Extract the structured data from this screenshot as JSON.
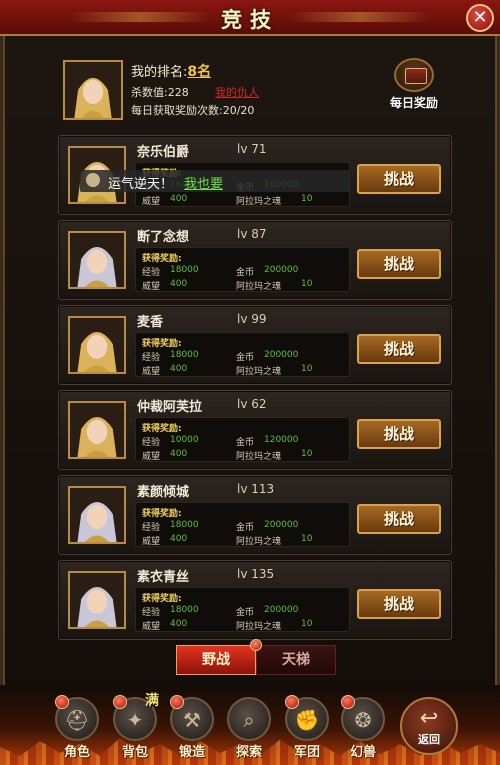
{
  "title": "竞技",
  "close_icon": "close-icon",
  "player": {
    "rank_label": "我的排名:",
    "rank_value": "8名",
    "kills_label": "杀数值:",
    "kills_value": "228",
    "enemy_link": "我的仇人",
    "daily_label": "每日获取奖励次数:",
    "daily_value": "20/20"
  },
  "daily_reward_label": "每日奖励",
  "toast": {
    "message": "运气逆天！",
    "link": "我也要"
  },
  "reward_header": "获得奖励:",
  "labels": {
    "exp": "经验",
    "prestige": "威望",
    "gold": "金币",
    "soul": "阿拉玛之魂"
  },
  "fight_label": "挑战",
  "opponents": [
    {
      "name": "奈乐伯爵",
      "level": "lv 71",
      "exp": "16000",
      "prestige": "400",
      "gold": "160000",
      "soul": "10",
      "hair": "#d9b25a"
    },
    {
      "name": "断了念想",
      "level": "lv 87",
      "exp": "18000",
      "prestige": "400",
      "gold": "200000",
      "soul": "10",
      "hair": "#c9c6d8"
    },
    {
      "name": "麦香",
      "level": "lv 99",
      "exp": "18000",
      "prestige": "400",
      "gold": "200000",
      "soul": "10",
      "hair": "#d9b25a"
    },
    {
      "name": "仲裁阿芙拉",
      "level": "lv 62",
      "exp": "10000",
      "prestige": "400",
      "gold": "120000",
      "soul": "10",
      "hair": "#d9b25a"
    },
    {
      "name": "素颜倾城",
      "level": "lv 113",
      "exp": "18000",
      "prestige": "400",
      "gold": "200000",
      "soul": "10",
      "hair": "#c9c6d8"
    },
    {
      "name": "素衣青丝",
      "level": "lv 135",
      "exp": "18000",
      "prestige": "400",
      "gold": "200000",
      "soul": "10",
      "hair": "#c9c6d8"
    }
  ],
  "tabs": {
    "active": "野战",
    "inactive": "天梯"
  },
  "nav": [
    {
      "label": "角色",
      "icon": "helmet-icon"
    },
    {
      "label": "背包",
      "icon": "bag-icon"
    },
    {
      "label": "锻造",
      "icon": "anvil-icon"
    },
    {
      "label": "探索",
      "icon": "magnifier-icon"
    },
    {
      "label": "军团",
      "icon": "gauntlet-icon"
    },
    {
      "label": "幻兽",
      "icon": "beast-icon"
    }
  ],
  "full_badge": "满",
  "back_label": "返回",
  "colors": {
    "title_bar": "#8b1710",
    "gold_text": "#f0c44a",
    "reward_green": "#5fbf3a",
    "enemy_red": "#d02a20"
  }
}
